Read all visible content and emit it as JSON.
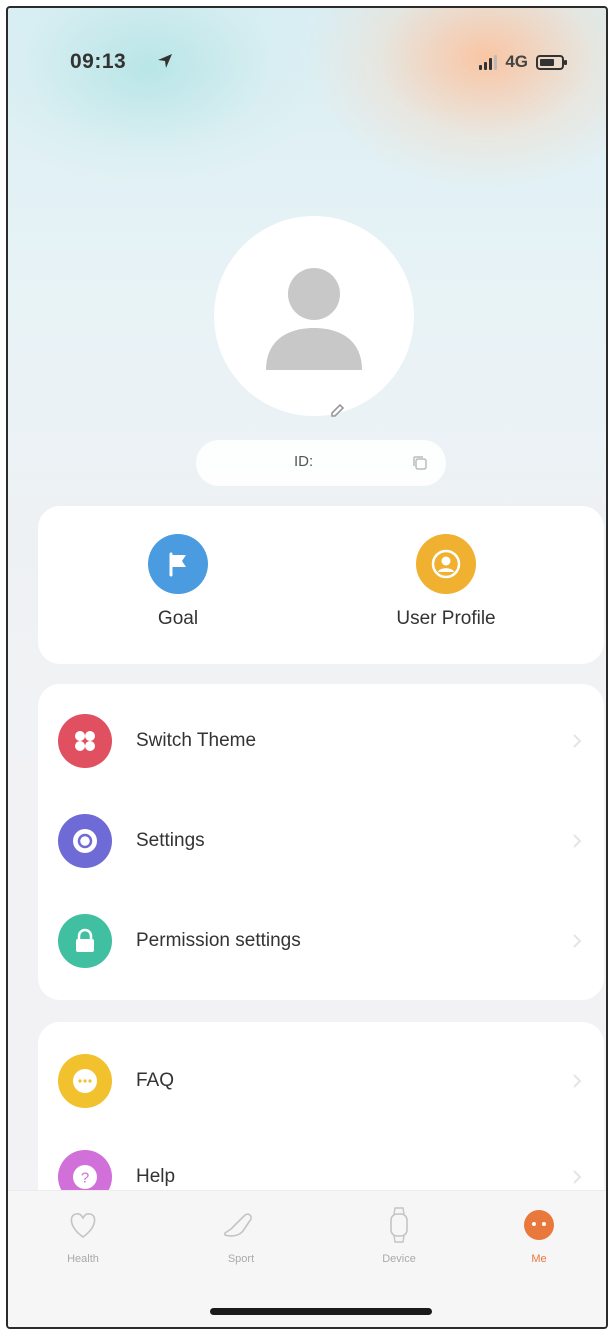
{
  "status_bar": {
    "time": "09:13",
    "network": "4G"
  },
  "profile": {
    "id_label": "ID:"
  },
  "quick_actions": [
    {
      "label": "Goal",
      "icon": "flag-icon",
      "color": "#4a9be0"
    },
    {
      "label": "User Profile",
      "icon": "user-icon",
      "color": "#f0b030"
    }
  ],
  "menu_group_1": [
    {
      "label": "Switch Theme",
      "icon": "theme-icon",
      "color": "#e05060"
    },
    {
      "label": "Settings",
      "icon": "settings-icon",
      "color": "#6f6bd6"
    },
    {
      "label": "Permission settings",
      "icon": "lock-icon",
      "color": "#40c0a0"
    }
  ],
  "menu_group_2": [
    {
      "label": "FAQ",
      "icon": "chat-icon",
      "color": "#f2c12e"
    },
    {
      "label": "Help",
      "icon": "question-icon",
      "color": "#d070d8"
    }
  ],
  "tabbar": {
    "tabs": [
      {
        "label": "Health",
        "icon": "heart-icon"
      },
      {
        "label": "Sport",
        "icon": "shoe-icon"
      },
      {
        "label": "Device",
        "icon": "watch-icon"
      },
      {
        "label": "Me",
        "icon": "me-icon",
        "active": true
      }
    ],
    "accent": "#e8783c"
  }
}
